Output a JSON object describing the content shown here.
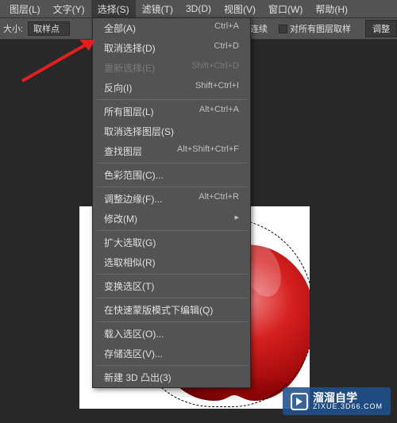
{
  "menu_bar": {
    "items": [
      "图层(L)",
      "文字(Y)",
      "选择(S)",
      "滤镜(T)",
      "3D(D)",
      "视图(V)",
      "窗口(W)",
      "帮助(H)"
    ],
    "active_index": 2
  },
  "toolbar": {
    "size_label": "大小:",
    "size_value": "取样点",
    "continuous_label": "连续",
    "sample_all_label": "对所有图层取样",
    "adjust_btn": "调整"
  },
  "menu": {
    "items": [
      {
        "label": "全部(A)",
        "shortcut": "Ctrl+A",
        "disabled": false
      },
      {
        "label": "取消选择(D)",
        "shortcut": "Ctrl+D",
        "disabled": false
      },
      {
        "label": "重新选择(E)",
        "shortcut": "Shift+Ctrl+D",
        "disabled": true
      },
      {
        "label": "反向(I)",
        "shortcut": "Shift+Ctrl+I",
        "disabled": false
      },
      {
        "sep": true
      },
      {
        "label": "所有图层(L)",
        "shortcut": "Alt+Ctrl+A",
        "disabled": false
      },
      {
        "label": "取消选择图层(S)",
        "shortcut": "",
        "disabled": false
      },
      {
        "label": "查找图层",
        "shortcut": "Alt+Shift+Ctrl+F",
        "disabled": false
      },
      {
        "sep": true
      },
      {
        "label": "色彩范围(C)...",
        "shortcut": "",
        "disabled": false
      },
      {
        "sep": true
      },
      {
        "label": "调整边缘(F)...",
        "shortcut": "Alt+Ctrl+R",
        "disabled": false
      },
      {
        "label": "修改(M)",
        "shortcut": "▸",
        "disabled": false
      },
      {
        "sep": true
      },
      {
        "label": "扩大选取(G)",
        "shortcut": "",
        "disabled": false
      },
      {
        "label": "选取相似(R)",
        "shortcut": "",
        "disabled": false
      },
      {
        "sep": true
      },
      {
        "label": "变换选区(T)",
        "shortcut": "",
        "disabled": false
      },
      {
        "sep": true
      },
      {
        "label": "在快速蒙版模式下编辑(Q)",
        "shortcut": "",
        "disabled": false
      },
      {
        "sep": true
      },
      {
        "label": "载入选区(O)...",
        "shortcut": "",
        "disabled": false
      },
      {
        "label": "存储选区(V)...",
        "shortcut": "",
        "disabled": false
      },
      {
        "sep": true
      },
      {
        "label": "新建 3D 凸出(3)",
        "shortcut": "",
        "disabled": false
      }
    ]
  },
  "watermark": {
    "zh": "溜溜自学",
    "en": "ZIXUE.3D66.COM"
  }
}
